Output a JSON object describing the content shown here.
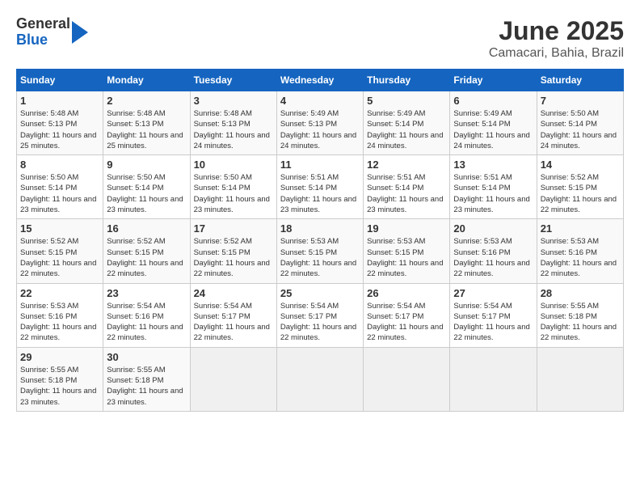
{
  "header": {
    "logo": {
      "general": "General",
      "blue": "Blue"
    },
    "title": "June 2025",
    "location": "Camacari, Bahia, Brazil"
  },
  "calendar": {
    "weekdays": [
      "Sunday",
      "Monday",
      "Tuesday",
      "Wednesday",
      "Thursday",
      "Friday",
      "Saturday"
    ],
    "weeks": [
      [
        null,
        {
          "day": "2",
          "sunrise": "Sunrise: 5:48 AM",
          "sunset": "Sunset: 5:13 PM",
          "daylight": "Daylight: 11 hours and 25 minutes."
        },
        {
          "day": "3",
          "sunrise": "Sunrise: 5:48 AM",
          "sunset": "Sunset: 5:13 PM",
          "daylight": "Daylight: 11 hours and 24 minutes."
        },
        {
          "day": "4",
          "sunrise": "Sunrise: 5:49 AM",
          "sunset": "Sunset: 5:13 PM",
          "daylight": "Daylight: 11 hours and 24 minutes."
        },
        {
          "day": "5",
          "sunrise": "Sunrise: 5:49 AM",
          "sunset": "Sunset: 5:14 PM",
          "daylight": "Daylight: 11 hours and 24 minutes."
        },
        {
          "day": "6",
          "sunrise": "Sunrise: 5:49 AM",
          "sunset": "Sunset: 5:14 PM",
          "daylight": "Daylight: 11 hours and 24 minutes."
        },
        {
          "day": "7",
          "sunrise": "Sunrise: 5:50 AM",
          "sunset": "Sunset: 5:14 PM",
          "daylight": "Daylight: 11 hours and 24 minutes."
        }
      ],
      [
        {
          "day": "1",
          "sunrise": "Sunrise: 5:48 AM",
          "sunset": "Sunset: 5:13 PM",
          "daylight": "Daylight: 11 hours and 25 minutes."
        },
        null,
        null,
        null,
        null,
        null,
        null
      ],
      [
        {
          "day": "8",
          "sunrise": "Sunrise: 5:50 AM",
          "sunset": "Sunset: 5:14 PM",
          "daylight": "Daylight: 11 hours and 23 minutes."
        },
        {
          "day": "9",
          "sunrise": "Sunrise: 5:50 AM",
          "sunset": "Sunset: 5:14 PM",
          "daylight": "Daylight: 11 hours and 23 minutes."
        },
        {
          "day": "10",
          "sunrise": "Sunrise: 5:50 AM",
          "sunset": "Sunset: 5:14 PM",
          "daylight": "Daylight: 11 hours and 23 minutes."
        },
        {
          "day": "11",
          "sunrise": "Sunrise: 5:51 AM",
          "sunset": "Sunset: 5:14 PM",
          "daylight": "Daylight: 11 hours and 23 minutes."
        },
        {
          "day": "12",
          "sunrise": "Sunrise: 5:51 AM",
          "sunset": "Sunset: 5:14 PM",
          "daylight": "Daylight: 11 hours and 23 minutes."
        },
        {
          "day": "13",
          "sunrise": "Sunrise: 5:51 AM",
          "sunset": "Sunset: 5:14 PM",
          "daylight": "Daylight: 11 hours and 23 minutes."
        },
        {
          "day": "14",
          "sunrise": "Sunrise: 5:52 AM",
          "sunset": "Sunset: 5:15 PM",
          "daylight": "Daylight: 11 hours and 22 minutes."
        }
      ],
      [
        {
          "day": "15",
          "sunrise": "Sunrise: 5:52 AM",
          "sunset": "Sunset: 5:15 PM",
          "daylight": "Daylight: 11 hours and 22 minutes."
        },
        {
          "day": "16",
          "sunrise": "Sunrise: 5:52 AM",
          "sunset": "Sunset: 5:15 PM",
          "daylight": "Daylight: 11 hours and 22 minutes."
        },
        {
          "day": "17",
          "sunrise": "Sunrise: 5:52 AM",
          "sunset": "Sunset: 5:15 PM",
          "daylight": "Daylight: 11 hours and 22 minutes."
        },
        {
          "day": "18",
          "sunrise": "Sunrise: 5:53 AM",
          "sunset": "Sunset: 5:15 PM",
          "daylight": "Daylight: 11 hours and 22 minutes."
        },
        {
          "day": "19",
          "sunrise": "Sunrise: 5:53 AM",
          "sunset": "Sunset: 5:15 PM",
          "daylight": "Daylight: 11 hours and 22 minutes."
        },
        {
          "day": "20",
          "sunrise": "Sunrise: 5:53 AM",
          "sunset": "Sunset: 5:16 PM",
          "daylight": "Daylight: 11 hours and 22 minutes."
        },
        {
          "day": "21",
          "sunrise": "Sunrise: 5:53 AM",
          "sunset": "Sunset: 5:16 PM",
          "daylight": "Daylight: 11 hours and 22 minutes."
        }
      ],
      [
        {
          "day": "22",
          "sunrise": "Sunrise: 5:53 AM",
          "sunset": "Sunset: 5:16 PM",
          "daylight": "Daylight: 11 hours and 22 minutes."
        },
        {
          "day": "23",
          "sunrise": "Sunrise: 5:54 AM",
          "sunset": "Sunset: 5:16 PM",
          "daylight": "Daylight: 11 hours and 22 minutes."
        },
        {
          "day": "24",
          "sunrise": "Sunrise: 5:54 AM",
          "sunset": "Sunset: 5:17 PM",
          "daylight": "Daylight: 11 hours and 22 minutes."
        },
        {
          "day": "25",
          "sunrise": "Sunrise: 5:54 AM",
          "sunset": "Sunset: 5:17 PM",
          "daylight": "Daylight: 11 hours and 22 minutes."
        },
        {
          "day": "26",
          "sunrise": "Sunrise: 5:54 AM",
          "sunset": "Sunset: 5:17 PM",
          "daylight": "Daylight: 11 hours and 22 minutes."
        },
        {
          "day": "27",
          "sunrise": "Sunrise: 5:54 AM",
          "sunset": "Sunset: 5:17 PM",
          "daylight": "Daylight: 11 hours and 22 minutes."
        },
        {
          "day": "28",
          "sunrise": "Sunrise: 5:55 AM",
          "sunset": "Sunset: 5:18 PM",
          "daylight": "Daylight: 11 hours and 22 minutes."
        }
      ],
      [
        {
          "day": "29",
          "sunrise": "Sunrise: 5:55 AM",
          "sunset": "Sunset: 5:18 PM",
          "daylight": "Daylight: 11 hours and 23 minutes."
        },
        {
          "day": "30",
          "sunrise": "Sunrise: 5:55 AM",
          "sunset": "Sunset: 5:18 PM",
          "daylight": "Daylight: 11 hours and 23 minutes."
        },
        null,
        null,
        null,
        null,
        null
      ]
    ]
  }
}
